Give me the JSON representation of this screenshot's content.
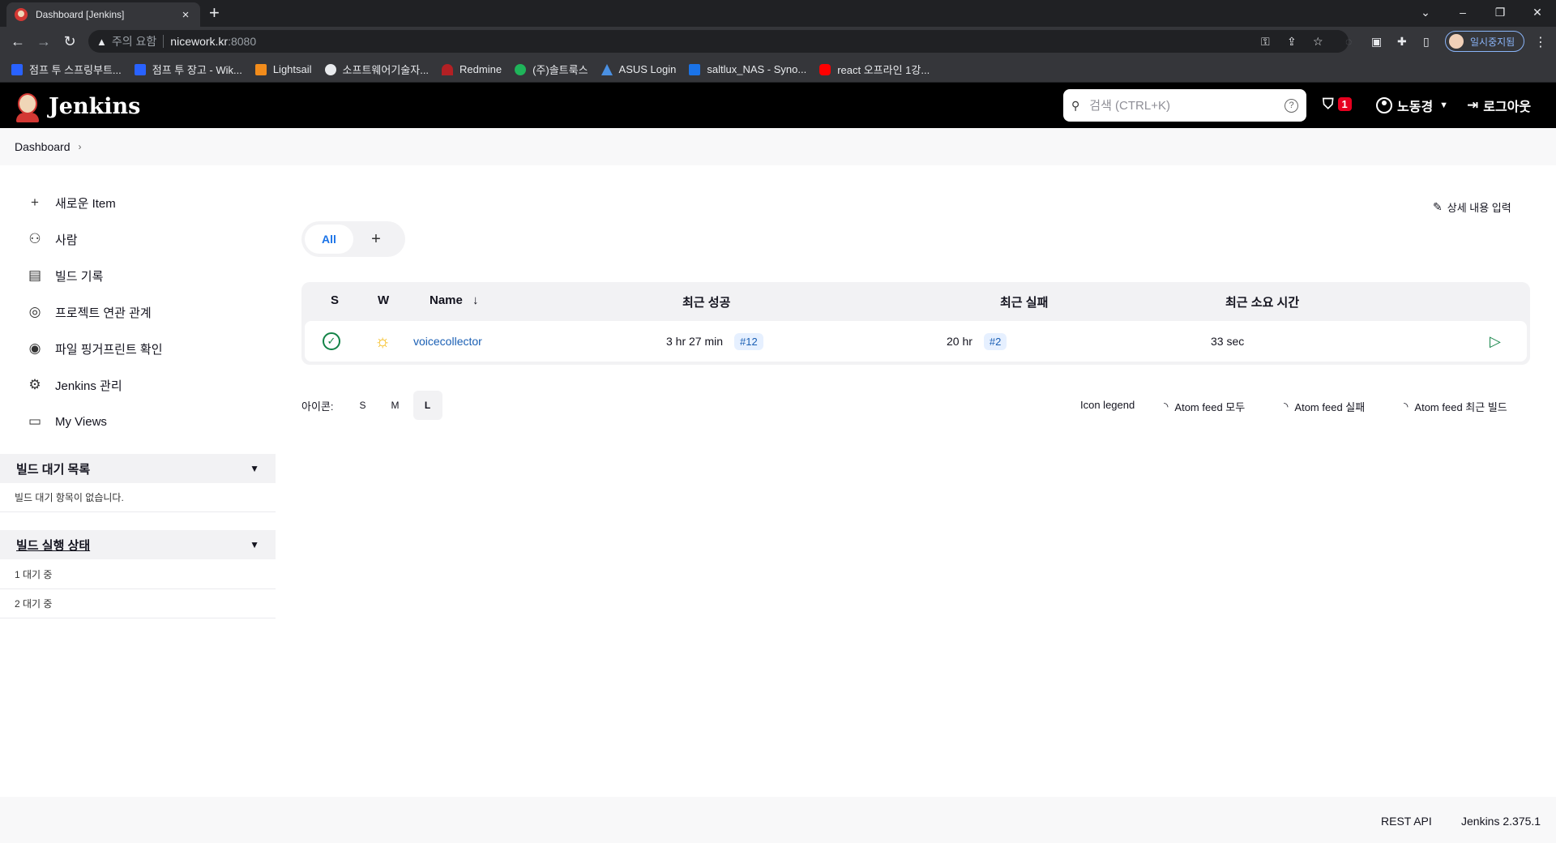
{
  "browser": {
    "tab_title": "Dashboard [Jenkins]",
    "tab_close": "×",
    "new_tab": "+",
    "window_controls": [
      "⌄",
      "–",
      "❐",
      "✕"
    ],
    "security_warning": "주의 요함",
    "url_host": "nicework.kr",
    "url_port": ":8080",
    "profile_label": "일시중지됨",
    "bookmarks": [
      {
        "label": "점프 투 스프링부트...",
        "icon": "wikidocs-icon",
        "color": "#2962ff"
      },
      {
        "label": "점프 투 장고 - Wik...",
        "icon": "wikidocs-icon",
        "color": "#2962ff"
      },
      {
        "label": "Lightsail",
        "icon": "lightsail-icon",
        "color": "#f28c1b"
      },
      {
        "label": "소프트웨어기술자...",
        "icon": "globe-icon",
        "color": "#e8eaed"
      },
      {
        "label": "Redmine",
        "icon": "redmine-icon",
        "color": "#b32024"
      },
      {
        "label": "(주)솔트룩스",
        "icon": "saltlux-icon",
        "color": "#1fb45a"
      },
      {
        "label": "ASUS Login",
        "icon": "asus-icon",
        "color": "#4a90e2"
      },
      {
        "label": "saltlux_NAS - Syno...",
        "icon": "dsm-icon",
        "color": "#1a73e8"
      },
      {
        "label": "react 오프라인 1강...",
        "icon": "youtube-icon",
        "color": "#ff0000"
      }
    ]
  },
  "jenkins_header": {
    "logo_text": "Jenkins",
    "search_placeholder": "검색 (CTRL+K)",
    "security_count": "1",
    "user_name": "노동경",
    "logout_label": "로그아웃"
  },
  "breadcrumb": {
    "dashboard": "Dashboard"
  },
  "sidebar": {
    "tasks": [
      {
        "label": "새로운 Item",
        "icon": "plus-icon"
      },
      {
        "label": "사람",
        "icon": "people-icon"
      },
      {
        "label": "빌드 기록",
        "icon": "build-history-icon"
      },
      {
        "label": "프로젝트 연관 관계",
        "icon": "relationship-icon"
      },
      {
        "label": "파일 핑거프린트 확인",
        "icon": "fingerprint-icon"
      },
      {
        "label": "Jenkins 관리",
        "icon": "gear-icon"
      },
      {
        "label": "My Views",
        "icon": "window-icon"
      }
    ],
    "build_queue": {
      "title": "빌드 대기 목록",
      "empty_text": "빌드 대기 항목이 없습니다."
    },
    "executors": {
      "title": "빌드 실행 상태",
      "rows": [
        "1  대기 중",
        "2  대기 중"
      ]
    }
  },
  "main": {
    "edit_description": "상세 내용 입력",
    "view_tabs": {
      "all": "All",
      "add": "+"
    },
    "table": {
      "headers": {
        "status": "S",
        "weather": "W",
        "name": "Name",
        "sort_arrow": "↓",
        "last_success": "최근 성공",
        "last_failure": "최근 실패",
        "last_duration": "최근 소요 시간"
      },
      "rows": [
        {
          "status": "success",
          "weather": "sunny",
          "name": "voicecollector",
          "last_success_time": "3 hr 27 min",
          "last_success_build": "#12",
          "last_failure_time": "20 hr",
          "last_failure_build": "#2",
          "last_duration": "33 sec"
        }
      ]
    },
    "icon_size": {
      "label": "아이콘:",
      "options": [
        "S",
        "M",
        "L"
      ],
      "selected": "L"
    },
    "links": {
      "icon_legend": "Icon legend",
      "feed_all": "Atom feed 모두",
      "feed_failures": "Atom feed 실패",
      "feed_latest": "Atom feed 최근 빌드"
    }
  },
  "footer": {
    "rest_api": "REST API",
    "version": "Jenkins 2.375.1"
  }
}
